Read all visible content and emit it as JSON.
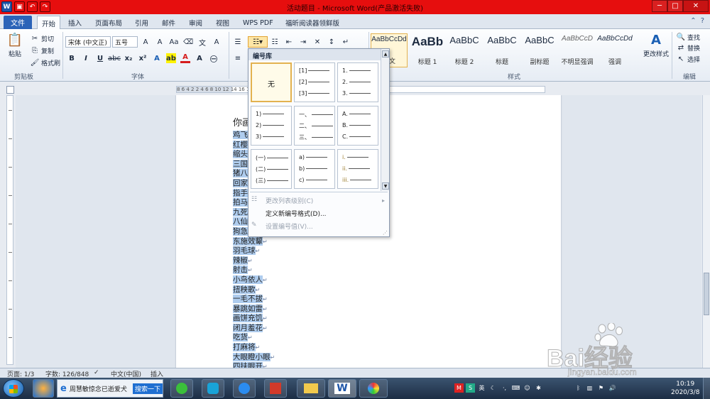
{
  "window": {
    "title": "活动题目 - Microsoft Word(产品激活失败)",
    "controls": [
      "─",
      "□",
      "✕"
    ]
  },
  "tabs": {
    "file": "文件",
    "items": [
      "开始",
      "插入",
      "页面布局",
      "引用",
      "邮件",
      "审阅",
      "视图",
      "WPS PDF",
      "福昕阅读器领鲜版"
    ],
    "active": "开始"
  },
  "ribbon": {
    "clipboard": {
      "paste": "粘贴",
      "cut": "剪切",
      "copy": "复制",
      "format_painter": "格式刷",
      "label": "剪贴板"
    },
    "font": {
      "name": "宋体 (中文正)",
      "size": "五号",
      "bold": "B",
      "italic": "I",
      "underline": "U",
      "strike": "abc",
      "subscript": "x₂",
      "superscript": "x²",
      "label": "字体"
    },
    "paragraph": {
      "label": "段落"
    },
    "styles": {
      "label": "样式",
      "tiles": [
        {
          "sample": "AaBbCcDd",
          "name": "正文"
        },
        {
          "sample": "AaBb",
          "name": "标题 1"
        },
        {
          "sample": "AaBbC",
          "name": "标题 2"
        },
        {
          "sample": "AaBbC",
          "name": "标题"
        },
        {
          "sample": "AaBbC",
          "name": "副标题"
        },
        {
          "sample": "AaBbCcD",
          "name": "不明显强调"
        },
        {
          "sample": "AaBbCcDd",
          "name": "强调"
        }
      ],
      "change_styles": "更改样式"
    },
    "editing": {
      "find": "查找",
      "replace": "替换",
      "select": "选择",
      "label": "编辑"
    }
  },
  "ruler": {
    "numbers": "8  6  4  2        2  4  6  8  10  12  14  16  18  20  22  24  26  28  30  32  34  36  38  40  42  44  46  48"
  },
  "numbering_menu": {
    "header": "编号库",
    "none": "无",
    "cells": [
      [
        "[1]",
        "[2]",
        "[3]"
      ],
      [
        "1.",
        "2.",
        "3."
      ],
      [
        "1)",
        "2)",
        "3)"
      ],
      [
        "一、",
        "二、",
        "三、"
      ],
      [
        "A.",
        "B.",
        "C."
      ],
      [
        "(一)",
        "(二)",
        "(三)"
      ],
      [
        "a)",
        "b)",
        "c)"
      ],
      [
        "i.",
        "ii.",
        "iii."
      ]
    ],
    "change_level": "更改列表级别(C)",
    "define_new": "定义新编号格式(D)...",
    "set_value": "设置编号值(V)..."
  },
  "document": {
    "heading": "你画",
    "lines": [
      "鸡飞狗跳",
      "红樱黄",
      "缩头乌龟",
      "三国演义",
      "猪八戒",
      "回家的",
      "指手画脚",
      "拍马屁",
      "九死一生",
      "八仙过海",
      "狗急跳墙",
      "东施效颦",
      "羽毛球",
      "辣椒",
      "射击",
      "小鸟依人",
      "扭秧歌",
      "一毛不拔",
      "暴跳如雷",
      "画饼充饥",
      "闭月羞花",
      "吃货",
      "打麻将",
      "大眼瞪小眼",
      "四扶眼开"
    ],
    "paragraph_mark": "↵"
  },
  "statusbar": {
    "page": "页面: 1/3",
    "words": "字数: 126/848",
    "language": "中文(中国)",
    "mode": "插入"
  },
  "taskbar": {
    "ie_title": "周慧敏惊念已逝爱犬",
    "ie_search": "搜索一下",
    "word_label": "W",
    "time": "10:19",
    "date": "2020/3/8"
  },
  "watermark": {
    "brand": "Bai经验",
    "url": "jingyan.baidu.com"
  }
}
